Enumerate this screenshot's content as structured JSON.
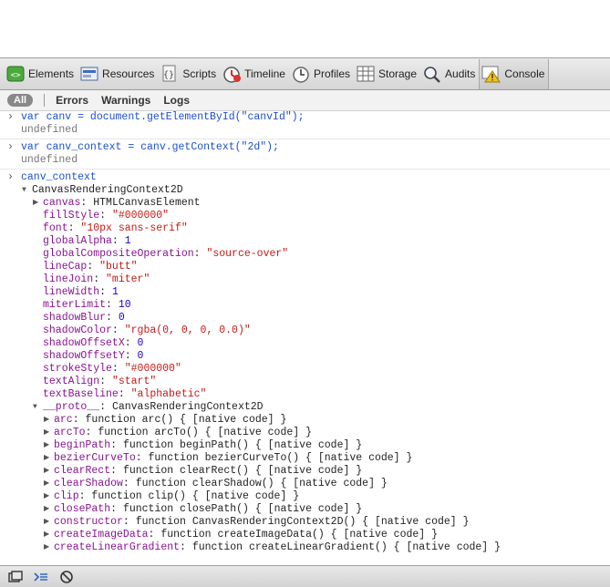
{
  "toolbar": {
    "items": [
      {
        "label": "Elements",
        "icon": "elements-icon"
      },
      {
        "label": "Resources",
        "icon": "resources-icon"
      },
      {
        "label": "Scripts",
        "icon": "scripts-icon"
      },
      {
        "label": "Timeline",
        "icon": "timeline-icon"
      },
      {
        "label": "Profiles",
        "icon": "profiles-icon"
      },
      {
        "label": "Storage",
        "icon": "storage-icon"
      },
      {
        "label": "Audits",
        "icon": "audits-icon"
      },
      {
        "label": "Console",
        "icon": "console-icon"
      }
    ]
  },
  "filters": {
    "all": "All",
    "errors": "Errors",
    "warnings": "Warnings",
    "logs": "Logs"
  },
  "console": {
    "cmd1": "var canv = document.getElementById(\"canvId\");",
    "res1": "undefined",
    "cmd2": "var canv_context = canv.getContext(\"2d\");",
    "res2": "undefined",
    "cmd3": "canv_context",
    "obj": "CanvasRenderingContext2D",
    "props": [
      {
        "name": "canvas",
        "sep": ": ",
        "value": "HTMLCanvasElement",
        "type": "plain",
        "expandable": true
      },
      {
        "name": "fillStyle",
        "sep": ": ",
        "value": "\"#000000\"",
        "type": "str"
      },
      {
        "name": "font",
        "sep": ": ",
        "value": "\"10px sans-serif\"",
        "type": "str"
      },
      {
        "name": "globalAlpha",
        "sep": ": ",
        "value": "1",
        "type": "num"
      },
      {
        "name": "globalCompositeOperation",
        "sep": ": ",
        "value": "\"source-over\"",
        "type": "str"
      },
      {
        "name": "lineCap",
        "sep": ": ",
        "value": "\"butt\"",
        "type": "str"
      },
      {
        "name": "lineJoin",
        "sep": ": ",
        "value": "\"miter\"",
        "type": "str"
      },
      {
        "name": "lineWidth",
        "sep": ": ",
        "value": "1",
        "type": "num"
      },
      {
        "name": "miterLimit",
        "sep": ": ",
        "value": "10",
        "type": "num"
      },
      {
        "name": "shadowBlur",
        "sep": ": ",
        "value": "0",
        "type": "num"
      },
      {
        "name": "shadowColor",
        "sep": ": ",
        "value": "\"rgba(0, 0, 0, 0.0)\"",
        "type": "str"
      },
      {
        "name": "shadowOffsetX",
        "sep": ": ",
        "value": "0",
        "type": "num"
      },
      {
        "name": "shadowOffsetY",
        "sep": ": ",
        "value": "0",
        "type": "num"
      },
      {
        "name": "strokeStyle",
        "sep": ": ",
        "value": "\"#000000\"",
        "type": "str"
      },
      {
        "name": "textAlign",
        "sep": ": ",
        "value": "\"start\"",
        "type": "str"
      },
      {
        "name": "textBaseline",
        "sep": ": ",
        "value": "\"alphabetic\"",
        "type": "str"
      }
    ],
    "proto_name": "__proto__",
    "proto_value": "CanvasRenderingContext2D",
    "proto_items": [
      {
        "name": "arc",
        "value": "function arc() { [native code] }"
      },
      {
        "name": "arcTo",
        "value": "function arcTo() { [native code] }"
      },
      {
        "name": "beginPath",
        "value": "function beginPath() { [native code] }"
      },
      {
        "name": "bezierCurveTo",
        "value": "function bezierCurveTo() { [native code] }"
      },
      {
        "name": "clearRect",
        "value": "function clearRect() { [native code] }"
      },
      {
        "name": "clearShadow",
        "value": "function clearShadow() { [native code] }"
      },
      {
        "name": "clip",
        "value": "function clip() { [native code] }"
      },
      {
        "name": "closePath",
        "value": "function closePath() { [native code] }"
      },
      {
        "name": "constructor",
        "value": "function CanvasRenderingContext2D() { [native code] }"
      },
      {
        "name": "createImageData",
        "value": "function createImageData() { [native code] }"
      },
      {
        "name": "createLinearGradient",
        "value": "function createLinearGradient() { [native code] }"
      }
    ]
  },
  "colors": {
    "accent": "#1c4fd1",
    "string": "#c41a16",
    "number": "#1c00cf",
    "property": "#881391"
  }
}
